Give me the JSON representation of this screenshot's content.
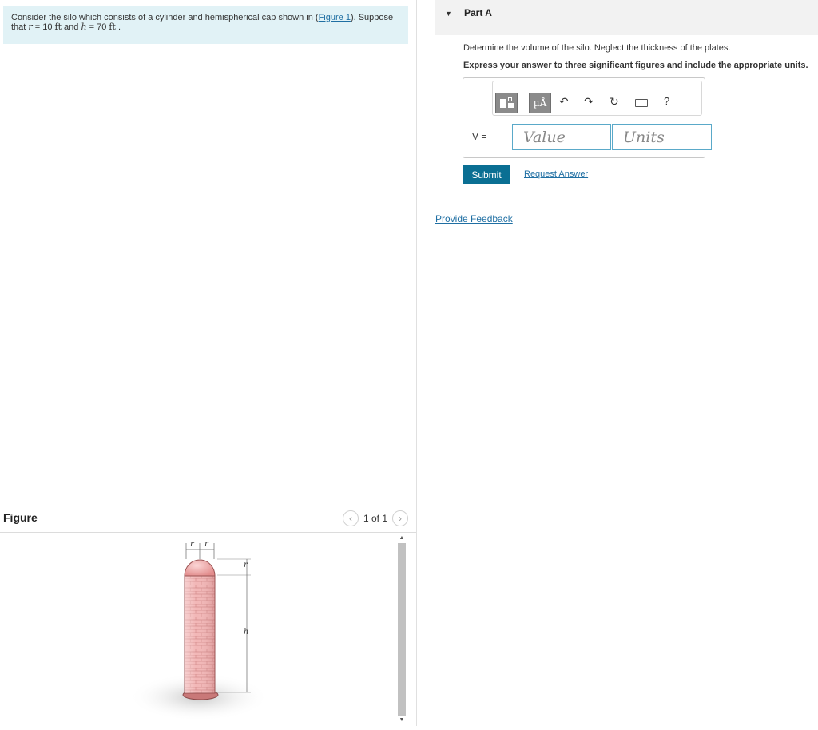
{
  "problem": {
    "text_before_link": "Consider the silo which consists of a cylinder and hemispherical cap shown in (",
    "link": "Figure 1",
    "text_after_link": "). Suppose",
    "line2_prefix": "that ",
    "r_symbol": "r",
    "r_eq": " = 10 ",
    "r_unit": "ft",
    "and_text": " and ",
    "h_symbol": "h",
    "h_eq": " = 70 ",
    "h_unit": "ft",
    "end": " ."
  },
  "figure": {
    "title": "Figure",
    "pager_text": "1 of 1",
    "prev_icon": "chevron-left-icon",
    "next_icon": "chevron-right-icon",
    "labels": {
      "r1": "r",
      "r2": "r",
      "r_side": "r",
      "h_side": "h"
    },
    "colors": {
      "brick": "#f2b6b6",
      "brick_dark": "#d07a7a",
      "shadow": "#e6e6e6"
    }
  },
  "part": {
    "title": "Part A",
    "question": "Determine the volume of the silo. Neglect the thickness of the plates.",
    "instruction": "Express your answer to three significant figures and include the appropriate units.",
    "variable_label": "V =",
    "value_placeholder": "Value",
    "units_placeholder": "Units",
    "toolbar": {
      "units_symbol": "µÅ",
      "undo_icon": "undo-icon",
      "redo_icon": "redo-icon",
      "reset_icon": "reset-icon",
      "keyboard_icon": "keyboard-icon",
      "help": "?"
    },
    "submit_label": "Submit",
    "request_answer_label": "Request Answer"
  },
  "feedback_label": "Provide Feedback",
  "colors": {
    "accent": "#0a6f93",
    "link": "#1f6fa3",
    "problem_bg": "#e1f2f6",
    "part_bar": "#f2f2f2"
  }
}
